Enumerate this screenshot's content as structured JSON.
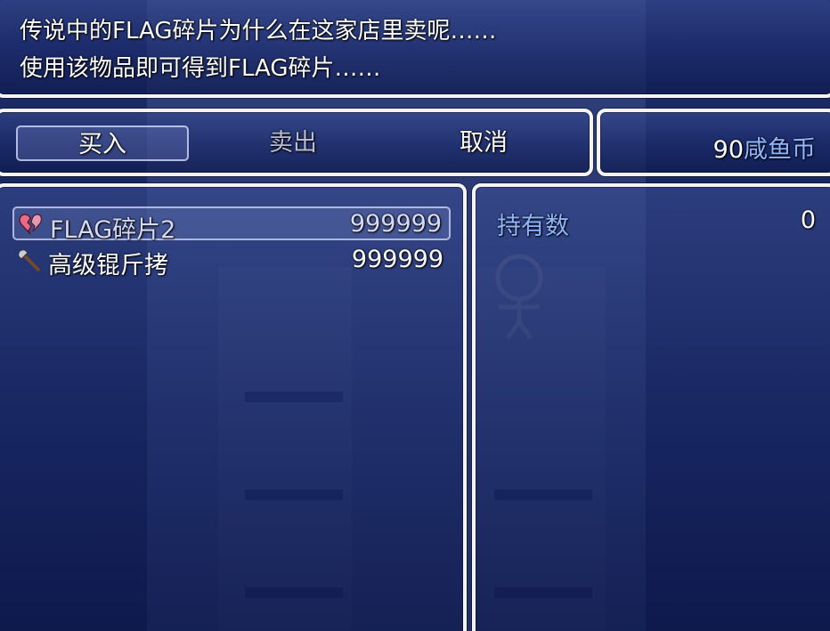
{
  "help": {
    "line1": "传说中的FLAG碎片为什么在这家店里卖呢……",
    "line2": "使用该物品即可得到FLAG碎片……"
  },
  "commands": [
    {
      "label": "买入",
      "selected": true
    },
    {
      "label": "卖出",
      "selected": false
    },
    {
      "label": "取消",
      "selected": false
    }
  ],
  "gold": {
    "amount": "90",
    "unit": "咸鱼币"
  },
  "items": [
    {
      "name": "FLAG碎片2",
      "price": "999999",
      "icon": "broken-heart-icon",
      "selected": true
    },
    {
      "name": "高级锟斤拷",
      "price": "999999",
      "icon": "axe-icon",
      "selected": false
    }
  ],
  "status": {
    "label": "持有数",
    "value": "0"
  },
  "colors": {
    "window_border": "#f4f4f4",
    "system_text": "#8fb6ff",
    "window_bg": "#1e2d6a"
  }
}
